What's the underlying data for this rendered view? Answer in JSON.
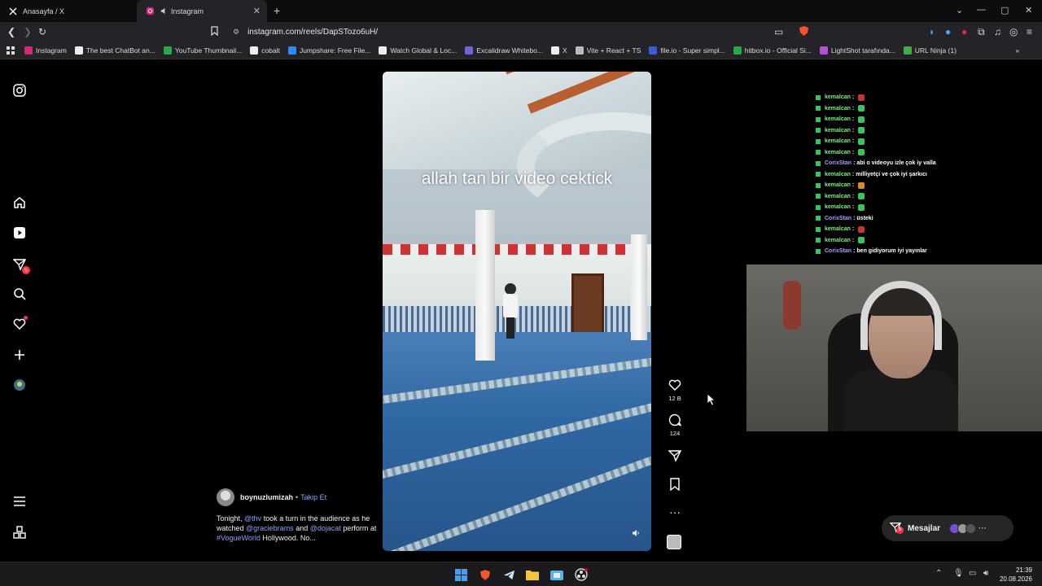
{
  "tabs": [
    {
      "label": "Anasayfa / X",
      "icon": "x-icon"
    },
    {
      "label": "Instagram",
      "icon": "instagram-icon"
    }
  ],
  "url": "instagram.com/reels/DapSTozo6uH/",
  "bookmarks": [
    {
      "label": "Instagram",
      "color": "#d62976"
    },
    {
      "label": "The best ChatBot an...",
      "color": "#eeeeee"
    },
    {
      "label": "YouTube Thumbnail...",
      "color": "#2aa84a"
    },
    {
      "label": "cobalt",
      "color": "#eeeeee"
    },
    {
      "label": "Jumpshare: Free File...",
      "color": "#2e8bff"
    },
    {
      "label": "Watch Global & Loc...",
      "color": "#eeeeee"
    },
    {
      "label": "Excalidraw Whitebo...",
      "color": "#6965db"
    },
    {
      "label": "X",
      "color": "#eeeeee"
    },
    {
      "label": "Vite + React + TS",
      "color": "#bbbbbb"
    },
    {
      "label": "file.io - Super simpl...",
      "color": "#3b5bdb"
    },
    {
      "label": "hitbox.io - Official Si...",
      "color": "#22aa44"
    },
    {
      "label": "LightShot tarafında...",
      "color": "#b44fd8"
    },
    {
      "label": "URL Ninja (1)",
      "color": "#44aa44"
    }
  ],
  "sidebar": {
    "notifications_badge": "5"
  },
  "reel": {
    "caption_overlay": "allah tan bir video cektick",
    "likes": "12 B",
    "comments": "124"
  },
  "post": {
    "username": "boynuzlumizah",
    "separator": "•",
    "follow_label": "Takip Et",
    "caption": {
      "p1": "Tonight, ",
      "m1": "@thv",
      "p2": " took a turn in the audience as he watched ",
      "m2": "@graciebrams",
      "p3": " and ",
      "m3": "@dojacat",
      "p4": " perform at ",
      "m4": "#VogueWorld",
      "p5": " Hollywood. No..."
    }
  },
  "chat": [
    {
      "user": "kemalcan",
      "sep": ":",
      "msg": "",
      "emote": "#c0392b",
      "cls": "u1"
    },
    {
      "user": "kemalcan",
      "sep": ":",
      "msg": "",
      "emote": "#39c35a",
      "cls": "u1"
    },
    {
      "user": "kemalcan",
      "sep": ":",
      "msg": "",
      "emote": "#39c35a",
      "cls": "u1"
    },
    {
      "user": "kemalcan",
      "sep": ":",
      "msg": "",
      "emote": "#39c35a",
      "cls": "u1"
    },
    {
      "user": "kemalcan",
      "sep": ":",
      "msg": "",
      "emote": "#39c35a",
      "cls": "u1"
    },
    {
      "user": "kemalcan",
      "sep": ":",
      "msg": "",
      "emote": "#39c35a",
      "cls": "u1"
    },
    {
      "user": "CorixStan",
      "sep": ":",
      "msg": "abi o videoyu izle çok iy valla",
      "emote": "",
      "cls": "u2"
    },
    {
      "user": "kemalcan",
      "sep": ":",
      "msg": "milliyetçi ve çok iyi şarkıcı",
      "emote": "",
      "cls": "u1"
    },
    {
      "user": "kemalcan",
      "sep": ":",
      "msg": "",
      "emote": "#d98a2b",
      "cls": "u1"
    },
    {
      "user": "kemalcan",
      "sep": ":",
      "msg": "",
      "emote": "#39c35a",
      "cls": "u1"
    },
    {
      "user": "kemalcan",
      "sep": ":",
      "msg": "",
      "emote": "#39c35a",
      "cls": "u1"
    },
    {
      "user": "CorixStan",
      "sep": ":",
      "msg": "üsteki",
      "emote": "",
      "cls": "u2"
    },
    {
      "user": "kemalcan",
      "sep": ":",
      "msg": "",
      "emote": "#c0392b",
      "cls": "u1"
    },
    {
      "user": "kemalcan",
      "sep": ":",
      "msg": "",
      "emote": "#39c35a",
      "cls": "u1"
    },
    {
      "user": "CorixStan",
      "sep": ":",
      "msg": "ben gidiyorum iyi yayınlar",
      "emote": "",
      "cls": "u2"
    }
  ],
  "messages": {
    "label": "Mesajlar",
    "badge": "5"
  },
  "clock": {
    "time": "21:39",
    "date": "20.08.2026"
  }
}
